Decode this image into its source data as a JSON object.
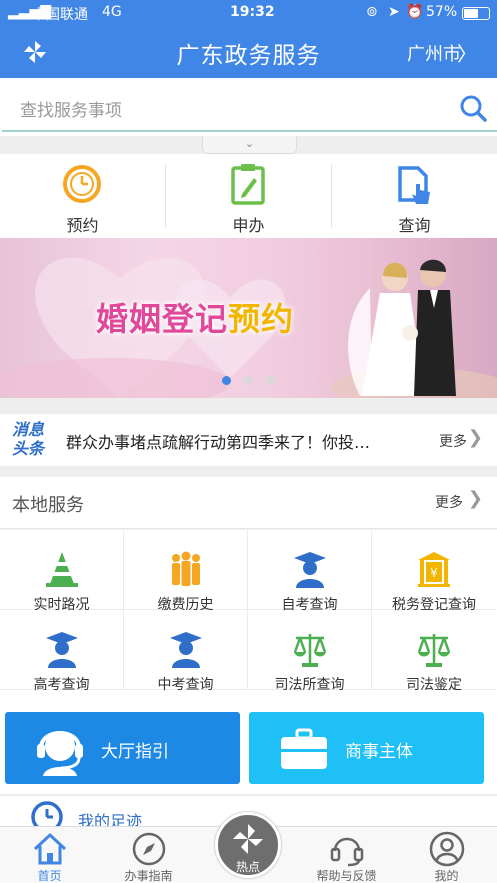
{
  "status_bar": {
    "carrier": "中国联通",
    "network": "4G",
    "time": "19:32",
    "battery": "57%"
  },
  "header": {
    "title": "广东政务服务",
    "city": "广州市",
    "city_chevron": "〉"
  },
  "search": {
    "placeholder": "查找服务事项"
  },
  "quick_actions": [
    {
      "label": "预约",
      "icon": "clock-refresh-icon"
    },
    {
      "label": "申办",
      "icon": "clipboard-edit-icon"
    },
    {
      "label": "查询",
      "icon": "document-touch-icon"
    }
  ],
  "banner": {
    "text_main": "婚姻登记",
    "text_highlight": "预约",
    "slide_index": 1,
    "slide_count": 3
  },
  "news": {
    "tag": "消息头条",
    "tag_line1": "消息",
    "tag_line2": "头条",
    "message": "群众办事堵点疏解行动第四季来了！你投…",
    "more": "更多"
  },
  "local_services": {
    "title": "本地服务",
    "more": "更多",
    "items": [
      {
        "label": "实时路况",
        "icon": "traffic-cone-icon"
      },
      {
        "label": "缴费历史",
        "icon": "people-group-icon"
      },
      {
        "label": "自考查询",
        "icon": "graduate-icon"
      },
      {
        "label": "税务登记查询",
        "icon": "tax-building-icon"
      },
      {
        "label": "高考查询",
        "icon": "graduate-icon"
      },
      {
        "label": "中考查询",
        "icon": "graduate-icon"
      },
      {
        "label": "司法所查询",
        "icon": "scales-icon"
      },
      {
        "label": "司法鉴定",
        "icon": "scales-icon"
      }
    ]
  },
  "big_buttons": [
    {
      "label": "大厅指引",
      "color": "#1e88e5",
      "icon": "headset-agent-icon"
    },
    {
      "label": "商事主体",
      "color": "#1ec0f5",
      "icon": "briefcase-icon"
    }
  ],
  "footprint": {
    "label": "我的足迹"
  },
  "tab_bar": [
    {
      "label": "首页",
      "icon": "home-icon",
      "active": true
    },
    {
      "label": "办事指南",
      "icon": "compass-icon",
      "active": false
    },
    {
      "label": "热点",
      "icon": "pinwheel-icon",
      "active": false
    },
    {
      "label": "帮助与反馈",
      "icon": "headset-icon",
      "active": false
    },
    {
      "label": "我的",
      "icon": "user-icon",
      "active": false
    }
  ],
  "colors": {
    "primary": "#3f86e6",
    "accent_green": "#4caf50",
    "accent_orange": "#f5a623"
  }
}
